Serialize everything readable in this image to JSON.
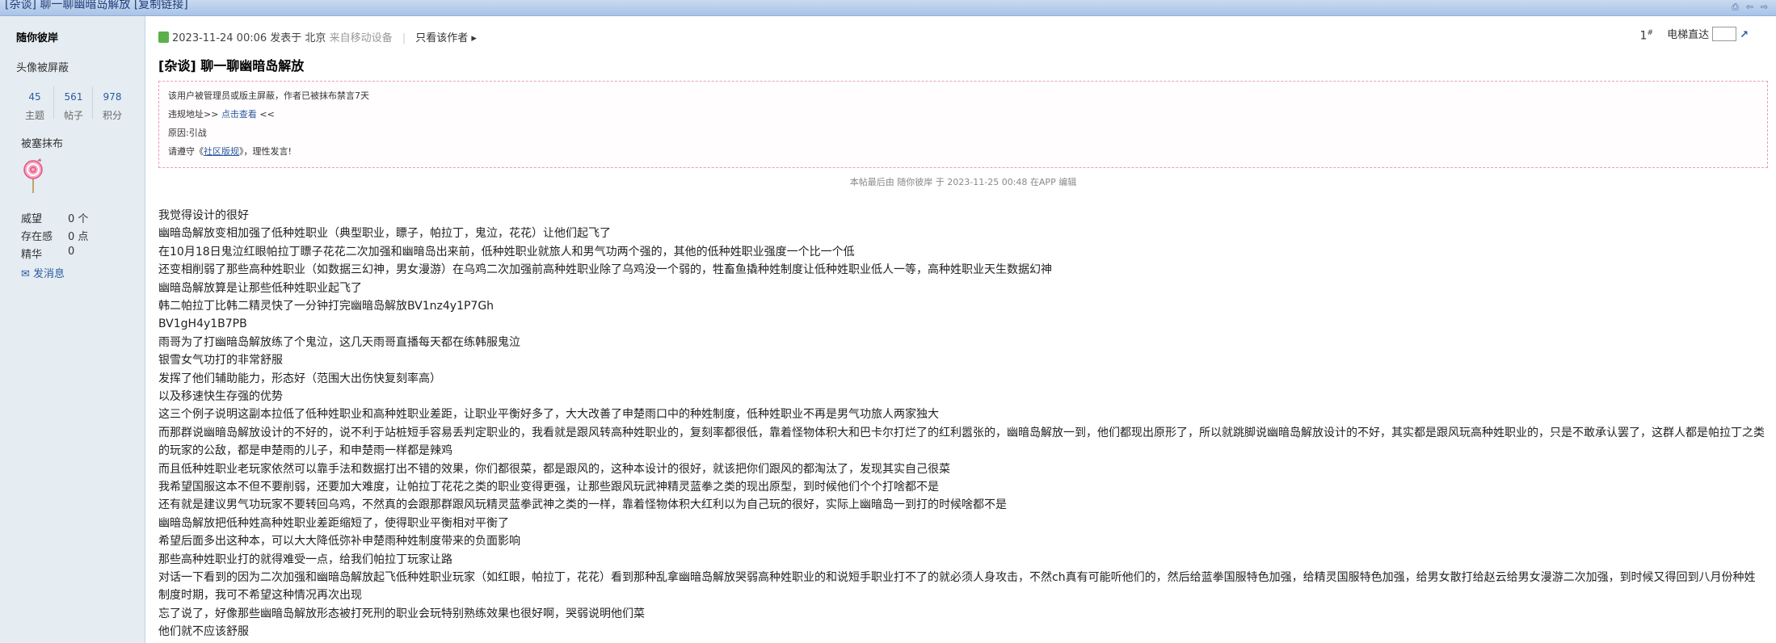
{
  "window": {
    "title": "[杂谈] 聊一聊幽暗岛解放 [复制链接]",
    "tool_icons": [
      "print-icon",
      "prev-icon",
      "next-icon"
    ]
  },
  "author": {
    "name": "随你彼岸",
    "avatar_status": "头像被屏蔽",
    "stats": [
      {
        "value": "45",
        "label": "主题"
      },
      {
        "value": "561",
        "label": "帖子"
      },
      {
        "value": "978",
        "label": "积分"
      }
    ],
    "group": "被塞抹布",
    "medal_icon": "lollipop-medal-icon",
    "attrs": [
      {
        "key": "威望",
        "value": "0 个"
      },
      {
        "key": "存在感",
        "value": "0 点"
      },
      {
        "key": "精华",
        "value": "0"
      }
    ],
    "pm_label": "发消息"
  },
  "post": {
    "meta_date": "2023-11-24 00:06 发表于 北京",
    "meta_device": "来自移动设备",
    "only_author": "只看该作者",
    "floor": "1",
    "floor_sup": "#",
    "jump_label": "电梯直达",
    "title": "[杂谈] 聊一聊幽暗岛解放",
    "notice": {
      "line1": "该用户被管理员或版主屏蔽，作者已被抹布禁言7天",
      "line2_prefix": "违规地址>> ",
      "line2_link": "点击查看",
      "line2_suffix": " <<",
      "line3": "原因:引战",
      "line4_prefix": "请遵守《",
      "line4_link": "社区版规",
      "line4_suffix": "》，理性发言!"
    },
    "edited": "本帖最后由 随你彼岸 于 2023-11-25 00:48 在APP 编辑",
    "lines": [
      "我觉得设计的很好",
      "幽暗岛解放变相加强了低种姓职业（典型职业，瞟子，帕拉丁，鬼泣，花花）让他们起飞了",
      "在10月18日鬼泣红眼帕拉丁瞟子花花二次加强和幽暗岛出来前，低种姓职业就旅人和男气功两个强的，其他的低种姓职业强度一个比一个低",
      "还变相削弱了那些高种姓职业（如数据三幻神，男女漫游）在乌鸡二次加强前高种姓职业除了乌鸡没一个弱的，牲畜鱼撬种姓制度让低种姓职业低人一等，高种姓职业天生数据幻神",
      "幽暗岛解放算是让那些低种姓职业起飞了",
      "韩二帕拉丁比韩二精灵快了一分钟打完幽暗岛解放BV1nz4y1P7Gh",
      "BV1gH4y1B7PB",
      "雨哥为了打幽暗岛解放练了个鬼泣，这几天雨哥直播每天都在练韩服鬼泣",
      "银雪女气功打的非常舒服",
      "发挥了他们辅助能力，形态好（范围大出伤快复刻率高）",
      "以及移速快生存强的优势",
      "这三个例子说明这副本拉低了低种姓职业和高种姓职业差距，让职业平衡好多了，大大改善了申楚雨口中的种姓制度，低种姓职业不再是男气功旅人两家独大",
      "而那群说幽暗岛解放设计的不好的，说不利于站桩短手容易丢判定职业的，我看就是跟风转高种姓职业的，复刻率都很低，靠着怪物体积大和巴卡尔打烂了的红利嚣张的，幽暗岛解放一到，他们都现出原形了，所以就跳脚说幽暗岛解放设计的不好，其实都是跟风玩高种姓职业的，只是不敢承认罢了，这群人都是帕拉丁之类的玩家的公敌，都是申楚雨的儿子，和申楚雨一样都是辣鸡",
      "而且低种姓职业老玩家依然可以靠手法和数据打出不错的效果，你们都很菜，都是跟风的，这种本设计的很好，就该把你们跟风的都淘汰了，发现其实自己很菜",
      "我希望国服这本不但不要削弱，还要加大难度，让帕拉丁花花之类的职业变得更强，让那些跟风玩武神精灵蓝拳之类的现出原型，到时候他们个个打啥都不是",
      "还有就是建议男气功玩家不要转回乌鸡，不然真的会跟那群跟风玩精灵蓝拳武神之类的一样，靠着怪物体积大红利以为自己玩的很好，实际上幽暗岛一到打的时候啥都不是",
      "幽暗岛解放把低种姓高种姓职业差距缩短了，使得职业平衡相对平衡了",
      "希望后面多出这种本，可以大大降低弥补申楚雨种姓制度带来的负面影响",
      "那些高种姓职业打的就得难受一点，给我们帕拉丁玩家让路",
      "对话一下看到的因为二次加强和幽暗岛解放起飞低种姓职业玩家（如红眼，帕拉丁，花花）看到那种乱拿幽暗岛解放哭弱高种姓职业的和说短手职业打不了的就必须人身攻击，不然ch真有可能听他们的，然后给蓝拳国服特色加强，给精灵国服特色加强，给男女散打给赵云给男女漫游二次加强，到时候又得回到八月份种姓制度时期，我可不希望这种情况再次出现",
      "忘了说了，好像那些幽暗岛解放形态被打死刑的职业会玩特别熟练效果也很好啊，哭弱说明他们菜",
      "他们就不应该舒服"
    ]
  }
}
